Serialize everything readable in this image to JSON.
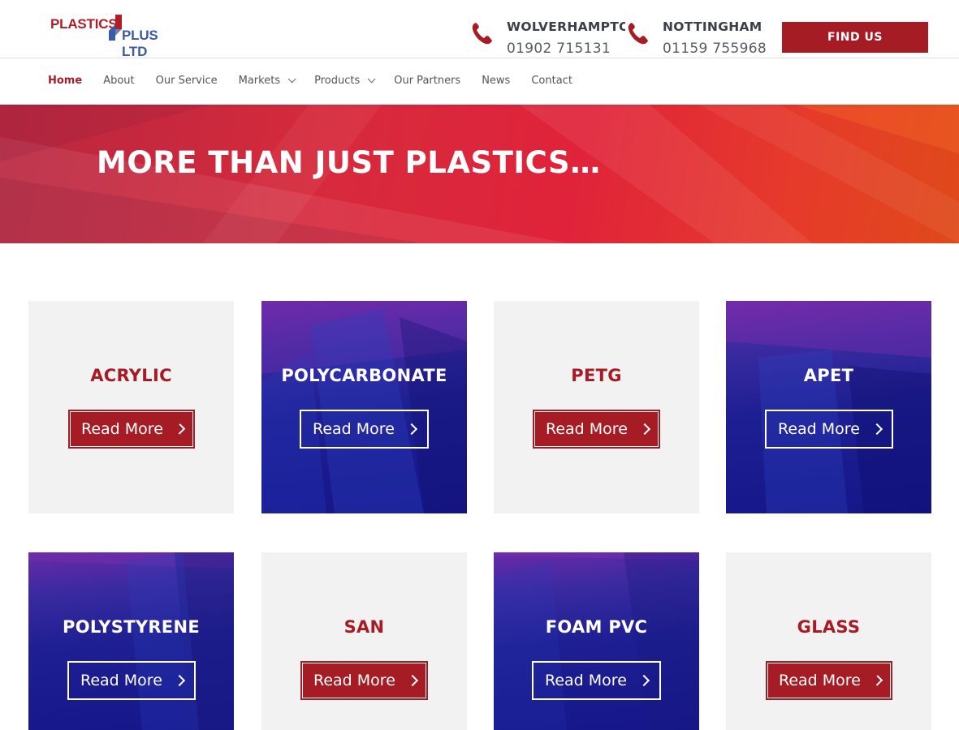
{
  "header": {
    "logo": {
      "line1": "PLASTICS",
      "line2": "PLUS LTD"
    },
    "contacts": [
      {
        "city": "WOLVERHAMPTON",
        "phone": "01902 715131"
      },
      {
        "city": "NOTTINGHAM",
        "phone": "01159 755968"
      }
    ],
    "find_us_label": "FIND US"
  },
  "nav": {
    "items": [
      {
        "label": "Home"
      },
      {
        "label": "About"
      },
      {
        "label": "Our Service"
      },
      {
        "label": "Markets"
      },
      {
        "label": "Products"
      },
      {
        "label": "Our Partners"
      },
      {
        "label": "News"
      },
      {
        "label": "Contact"
      }
    ]
  },
  "hero": {
    "title": "MORE THAN JUST PLASTICS…"
  },
  "products": [
    {
      "name": "ACRYLIC",
      "button": "Read More"
    },
    {
      "name": "POLYCARBONATE",
      "button": "Read More"
    },
    {
      "name": "PETG",
      "button": "Read More"
    },
    {
      "name": "APET",
      "button": "Read More"
    },
    {
      "name": "POLYSTYRENE",
      "button": "Read More"
    },
    {
      "name": "SAN",
      "button": "Read More"
    },
    {
      "name": "FOAM PVC",
      "button": "Read More"
    },
    {
      "name": "GLASS",
      "button": "Read More"
    }
  ],
  "colors": {
    "brand_red": "#a51c24",
    "brand_blue": "#3b5aa8",
    "card_light": "#f2f2f2",
    "card_dark": "#1e1f92"
  },
  "icons": {
    "phone": "phone-icon",
    "chevron": "chevron-down-icon",
    "arrow": "chevron-right-icon"
  }
}
